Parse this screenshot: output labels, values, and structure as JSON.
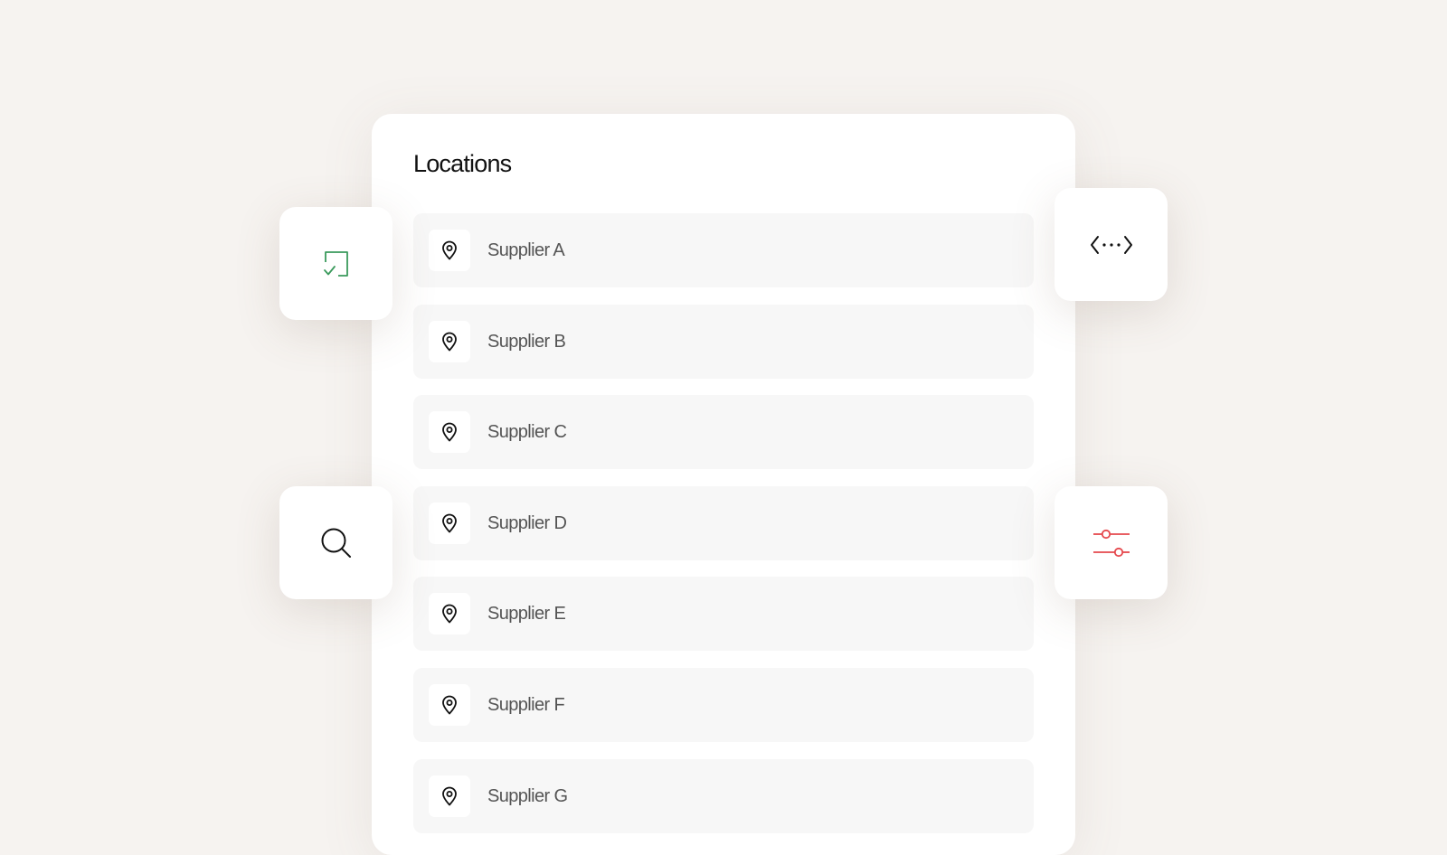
{
  "panel": {
    "title": "Locations",
    "items": [
      {
        "label": "Supplier A",
        "icon": "map-pin-icon"
      },
      {
        "label": "Supplier B",
        "icon": "map-pin-icon"
      },
      {
        "label": "Supplier C",
        "icon": "map-pin-icon"
      },
      {
        "label": "Supplier D",
        "icon": "map-pin-icon"
      },
      {
        "label": "Supplier E",
        "icon": "map-pin-icon"
      },
      {
        "label": "Supplier F",
        "icon": "map-pin-icon"
      },
      {
        "label": "Supplier G",
        "icon": "map-pin-icon"
      }
    ]
  },
  "tiles": {
    "left_top": {
      "icon": "checked-square-icon",
      "color": "#3a9a5c"
    },
    "left_bottom": {
      "icon": "search-icon",
      "color": "#111111"
    },
    "right_top": {
      "icon": "code-icon",
      "color": "#111111"
    },
    "right_bottom": {
      "icon": "sliders-icon",
      "color": "#e5484d"
    }
  },
  "colors": {
    "background": "#f6f3f0",
    "panel": "#ffffff",
    "row": "#f7f7f7",
    "label": "#555555"
  }
}
